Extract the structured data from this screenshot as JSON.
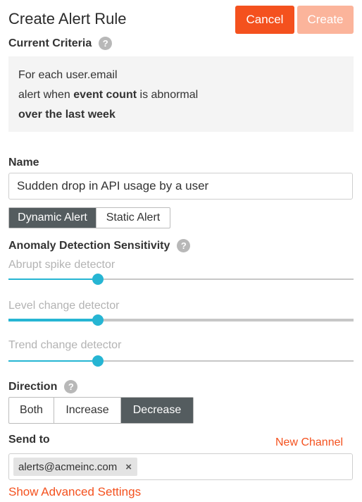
{
  "header": {
    "title": "Create Alert Rule",
    "cancel_label": "Cancel",
    "create_label": "Create"
  },
  "criteria": {
    "heading": "Current Criteria",
    "line1": "For each user.email",
    "line2_prefix": "alert when ",
    "line2_bold": "event count",
    "line2_suffix": " is abnormal",
    "line3": "over the last week"
  },
  "name": {
    "label": "Name",
    "value": "Sudden drop in API usage by a user"
  },
  "alert_type": {
    "options": [
      "Dynamic Alert",
      "Static Alert"
    ],
    "selected": "Dynamic Alert"
  },
  "sensitivity": {
    "heading": "Anomaly Detection Sensitivity",
    "detectors": [
      {
        "label": "Abrupt spike detector",
        "level": 0.26
      },
      {
        "label": "Level change detector",
        "level": 0.26
      },
      {
        "label": "Trend change detector",
        "level": 0.26
      }
    ]
  },
  "direction": {
    "label": "Direction",
    "options": [
      "Both",
      "Increase",
      "Decrease"
    ],
    "selected": "Decrease"
  },
  "send_to": {
    "label": "Send to",
    "new_channel_label": "New Channel",
    "recipients": [
      "alerts@acmeinc.com"
    ],
    "remove_glyph": "×"
  },
  "advanced": {
    "label": "Show Advanced Settings"
  },
  "colors": {
    "accent": "#f4511e",
    "slider": "#26b5d3",
    "active_toggle": "#545c5f"
  }
}
